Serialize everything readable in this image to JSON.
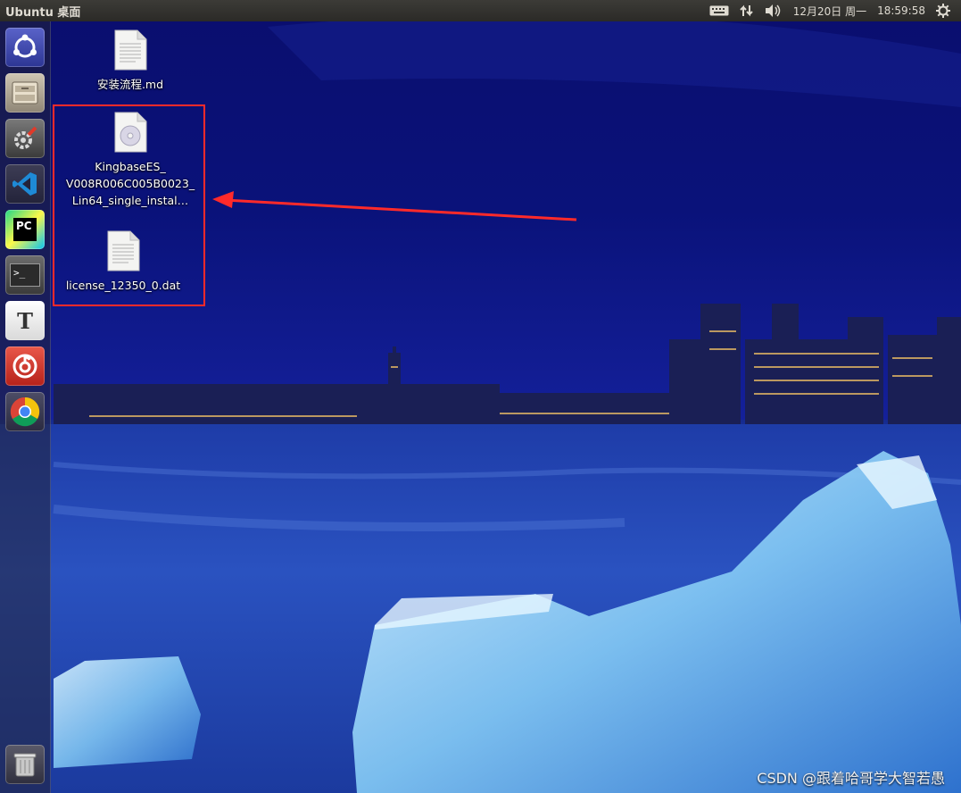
{
  "panel": {
    "title": "Ubuntu 桌面",
    "date": "12月20日 周一",
    "time": "18:59:58",
    "icons": [
      "keyboard-icon",
      "network-icon",
      "volume-icon",
      "settings-gear-icon"
    ]
  },
  "launcher": {
    "items": [
      {
        "name": "ubuntu-dash",
        "icon": "ubuntu-logo-icon"
      },
      {
        "name": "files",
        "icon": "file-manager-icon"
      },
      {
        "name": "system-settings",
        "icon": "settings-icon"
      },
      {
        "name": "vscode",
        "icon": "vscode-icon"
      },
      {
        "name": "pycharm",
        "icon": "pycharm-icon",
        "text": "PC"
      },
      {
        "name": "terminal",
        "icon": "terminal-icon",
        "text": ">_"
      },
      {
        "name": "text-editor",
        "icon": "typora-icon",
        "text": "T"
      },
      {
        "name": "netease-music",
        "icon": "netease-music-icon"
      },
      {
        "name": "chrome",
        "icon": "chrome-icon"
      },
      {
        "name": "trash",
        "icon": "trash-icon"
      }
    ]
  },
  "desktop": {
    "files": [
      {
        "name": "安装流程.md",
        "lines": [
          "安装流程.md"
        ],
        "type": "text-file"
      },
      {
        "name": "kingbase-installer",
        "lines": [
          "KingbaseES_",
          "V008R006C005B0023_",
          "Lin64_single_instal…"
        ],
        "type": "disc-image"
      },
      {
        "name": "license",
        "lines": [
          "license_12350_0.dat"
        ],
        "type": "text-file"
      }
    ]
  },
  "annotation": {
    "box_color": "#ff2a2a",
    "arrow_color": "#ff2a2a"
  },
  "watermark": "CSDN @跟着哈哥学大智若愚"
}
